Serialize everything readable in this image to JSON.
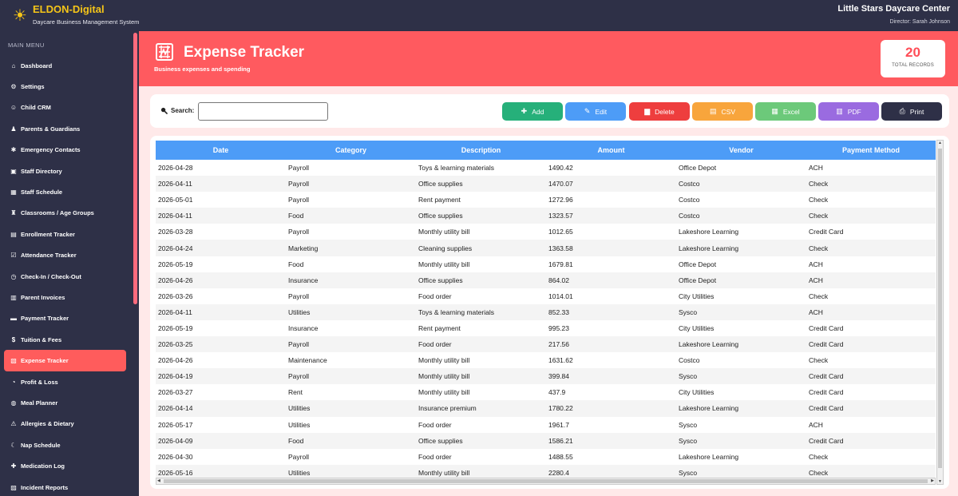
{
  "app": {
    "brand": "ELDON-Digital",
    "subtitle": "Daycare Business Management System",
    "center_name": "Little Stars Daycare Center",
    "director": "Director: Sarah Johnson"
  },
  "sidebar": {
    "heading": "MAIN MENU",
    "items": [
      {
        "label": "Dashboard",
        "icon": "home-icon",
        "glyph": "⌂"
      },
      {
        "label": "Settings",
        "icon": "gear-icon",
        "glyph": "⚙"
      },
      {
        "label": "Child CRM",
        "icon": "child-icon",
        "glyph": "☺"
      },
      {
        "label": "Parents & Guardians",
        "icon": "users-icon",
        "glyph": "♟"
      },
      {
        "label": "Emergency Contacts",
        "icon": "emergency-icon",
        "glyph": "✱"
      },
      {
        "label": "Staff Directory",
        "icon": "directory-icon",
        "glyph": "▣"
      },
      {
        "label": "Staff Schedule",
        "icon": "calendar-icon",
        "glyph": "▦"
      },
      {
        "label": "Classrooms / Age Groups",
        "icon": "classroom-icon",
        "glyph": "♜"
      },
      {
        "label": "Enrollment Tracker",
        "icon": "clipboard-icon",
        "glyph": "▤"
      },
      {
        "label": "Attendance Tracker",
        "icon": "checkbox-icon",
        "glyph": "☑"
      },
      {
        "label": "Check-In / Check-Out",
        "icon": "clock-icon",
        "glyph": "◷"
      },
      {
        "label": "Parent Invoices",
        "icon": "invoice-icon",
        "glyph": "▥"
      },
      {
        "label": "Payment Tracker",
        "icon": "card-icon",
        "glyph": "▬"
      },
      {
        "label": "Tuition & Fees",
        "icon": "money-icon",
        "glyph": "$"
      },
      {
        "label": "Expense Tracker",
        "icon": "receipt-icon",
        "glyph": "▧"
      },
      {
        "label": "Profit & Loss",
        "icon": "chart-icon",
        "glyph": "◔"
      },
      {
        "label": "Meal Planner",
        "icon": "meal-icon",
        "glyph": "◍"
      },
      {
        "label": "Allergies & Dietary",
        "icon": "warning-icon",
        "glyph": "⚠"
      },
      {
        "label": "Nap Schedule",
        "icon": "moon-icon",
        "glyph": "☾"
      },
      {
        "label": "Medication Log",
        "icon": "pill-icon",
        "glyph": "✚"
      },
      {
        "label": "Incident Reports",
        "icon": "report-icon",
        "glyph": "▨"
      }
    ],
    "active_index": 14
  },
  "header": {
    "title": "Expense Tracker",
    "subtitle": "Business expenses and spending",
    "record_count": "20",
    "record_label": "TOTAL RECORDS"
  },
  "toolbar": {
    "search_label": "Search:",
    "search_value": "",
    "search_placeholder": "",
    "buttons": {
      "add": "Add",
      "edit": "Edit",
      "delete": "Delete",
      "csv": "CSV",
      "excel": "Excel",
      "pdf": "PDF",
      "print": "Print"
    }
  },
  "table": {
    "columns": [
      "Date",
      "Category",
      "Description",
      "Amount",
      "Vendor",
      "Payment Method"
    ],
    "rows": [
      [
        "2026-04-28",
        "Payroll",
        "Toys & learning materials",
        "1490.42",
        "Office Depot",
        "ACH"
      ],
      [
        "2026-04-11",
        "Payroll",
        "Office supplies",
        "1470.07",
        "Costco",
        "Check"
      ],
      [
        "2026-05-01",
        "Payroll",
        "Rent payment",
        "1272.96",
        "Costco",
        "Check"
      ],
      [
        "2026-04-11",
        "Food",
        "Office supplies",
        "1323.57",
        "Costco",
        "Check"
      ],
      [
        "2026-03-28",
        "Payroll",
        "Monthly utility bill",
        "1012.65",
        "Lakeshore Learning",
        "Credit Card"
      ],
      [
        "2026-04-24",
        "Marketing",
        "Cleaning supplies",
        "1363.58",
        "Lakeshore Learning",
        "Check"
      ],
      [
        "2026-05-19",
        "Food",
        "Monthly utility bill",
        "1679.81",
        "Office Depot",
        "ACH"
      ],
      [
        "2026-04-26",
        "Insurance",
        "Office supplies",
        "864.02",
        "Office Depot",
        "ACH"
      ],
      [
        "2026-03-26",
        "Payroll",
        "Food order",
        "1014.01",
        "City Utilities",
        "Check"
      ],
      [
        "2026-04-11",
        "Utilities",
        "Toys & learning materials",
        "852.33",
        "Sysco",
        "ACH"
      ],
      [
        "2026-05-19",
        "Insurance",
        "Rent payment",
        "995.23",
        "City Utilities",
        "Credit Card"
      ],
      [
        "2026-03-25",
        "Payroll",
        "Food order",
        "217.56",
        "Lakeshore Learning",
        "Credit Card"
      ],
      [
        "2026-04-26",
        "Maintenance",
        "Monthly utility bill",
        "1631.62",
        "Costco",
        "Check"
      ],
      [
        "2026-04-19",
        "Payroll",
        "Monthly utility bill",
        "399.84",
        "Sysco",
        "Credit Card"
      ],
      [
        "2026-03-27",
        "Rent",
        "Monthly utility bill",
        "437.9",
        "City Utilities",
        "Credit Card"
      ],
      [
        "2026-04-14",
        "Utilities",
        "Insurance premium",
        "1780.22",
        "Lakeshore Learning",
        "Credit Card"
      ],
      [
        "2026-05-17",
        "Utilities",
        "Food order",
        "1961.7",
        "Sysco",
        "ACH"
      ],
      [
        "2026-04-09",
        "Food",
        "Office supplies",
        "1586.21",
        "Sysco",
        "Credit Card"
      ],
      [
        "2026-04-30",
        "Payroll",
        "Food order",
        "1488.55",
        "Lakeshore Learning",
        "Check"
      ],
      [
        "2026-05-16",
        "Utilities",
        "Monthly utility bill",
        "2280.4",
        "Sysco",
        "Check"
      ]
    ]
  },
  "colors": {
    "sidebar_bg": "#2e3047",
    "accent_red": "#ff5a5f",
    "header_blue": "#4d9cf7",
    "brand_yellow": "#f5c518"
  }
}
